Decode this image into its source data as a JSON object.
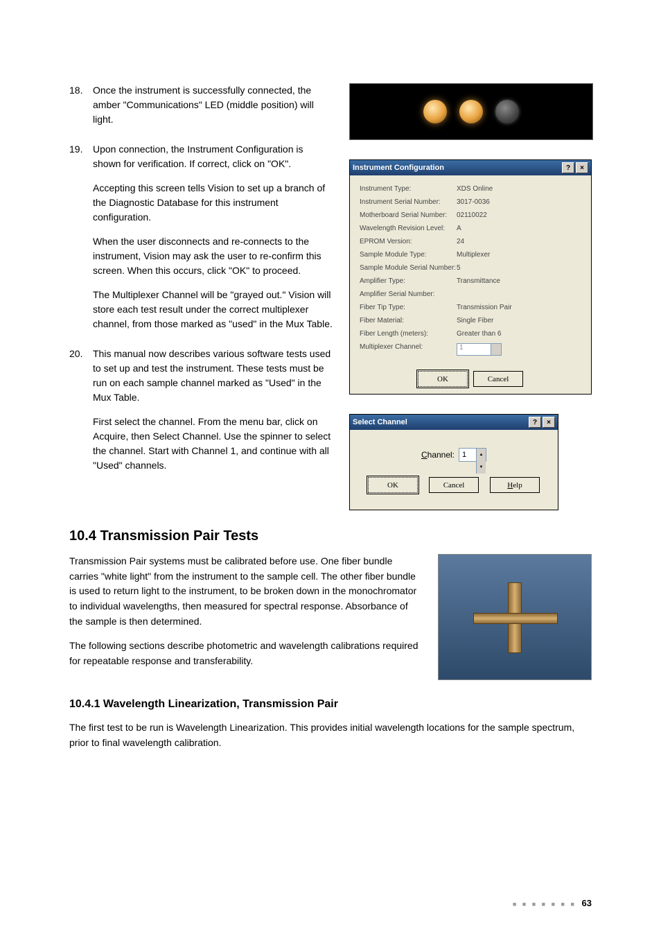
{
  "steps": {
    "s18": {
      "num": "18.",
      "text": "Once the instrument is successfully connected, the amber \"Communications\" LED (middle position) will light."
    },
    "s19": {
      "num": "19.",
      "p1": "Upon connection, the Instrument Configuration is shown for verification. If correct, click on \"OK\".",
      "p2": "Accepting this screen tells Vision to set up a branch of the Diagnostic Database for this instrument configuration.",
      "p3": "When the user disconnects and re-connects to the instrument, Vision may ask the user to re-confirm this screen. When this occurs, click \"OK\" to proceed.",
      "p4": "The Multiplexer Channel will be \"grayed out.\" Vision will store each test result under the correct multiplexer channel, from those marked as \"used\" in the Mux Table."
    },
    "s20": {
      "num": "20.",
      "p1": "This manual now describes various software tests used to set up and test the instrument. These tests must be run on each sample channel marked as \"Used\" in the Mux Table.",
      "p2": "First select the channel. From the menu bar, click on Acquire, then Select Channel. Use the spinner to select the channel. Start with Channel 1, and continue with all \"Used\" channels."
    }
  },
  "cfg_dialog": {
    "title": "Instrument Configuration",
    "rows": [
      {
        "k": "Instrument Type:",
        "v": "XDS Online"
      },
      {
        "k": "Instrument Serial Number:",
        "v": "3017-0036"
      },
      {
        "k": "Motherboard Serial Number:",
        "v": "02110022"
      },
      {
        "k": "Wavelength Revision Level:",
        "v": "A"
      },
      {
        "k": "EPROM Version:",
        "v": "24"
      },
      {
        "k": "Sample Module Type:",
        "v": "Multiplexer"
      },
      {
        "k": "Sample Module Serial Number:",
        "v": "5"
      },
      {
        "k": "Amplifier Type:",
        "v": "Transmittance"
      },
      {
        "k": "Amplifier Serial Number:",
        "v": ""
      },
      {
        "k": "Fiber Tip Type:",
        "v": "Transmission Pair"
      },
      {
        "k": "Fiber Material:",
        "v": "Single Fiber"
      },
      {
        "k": "Fiber Length (meters):",
        "v": "Greater than 6"
      }
    ],
    "mux_label": "Multiplexer Channel:",
    "mux_value": "1",
    "ok": "OK",
    "cancel": "Cancel"
  },
  "sel_dialog": {
    "title": "Select Channel",
    "label_pre": "C",
    "label_rest": "hannel:",
    "value": "1",
    "ok": "OK",
    "cancel": "Cancel",
    "help_pre": "H",
    "help_rest": "elp"
  },
  "section": {
    "h2": "10.4 Transmission Pair Tests",
    "p1": "Transmission Pair systems must be calibrated before use. One fiber bundle carries \"white light\" from the instrument to the sample cell. The other fiber bundle is used to return light to the instrument, to be broken down in the monochromator to individual wavelengths, then measured for spectral response. Absorbance of the sample is then determined.",
    "p2": "The following sections describe photometric and wavelength calibrations required for repeatable response and transferability.",
    "h3": "10.4.1   Wavelength Linearization, Transmission Pair",
    "p3": "The first test to be run is Wavelength Linearization. This provides initial wavelength locations for the sample spectrum, prior to final wavelength calibration."
  },
  "footer": {
    "dots": "■ ■ ■ ■ ■ ■ ■",
    "page": "63"
  }
}
